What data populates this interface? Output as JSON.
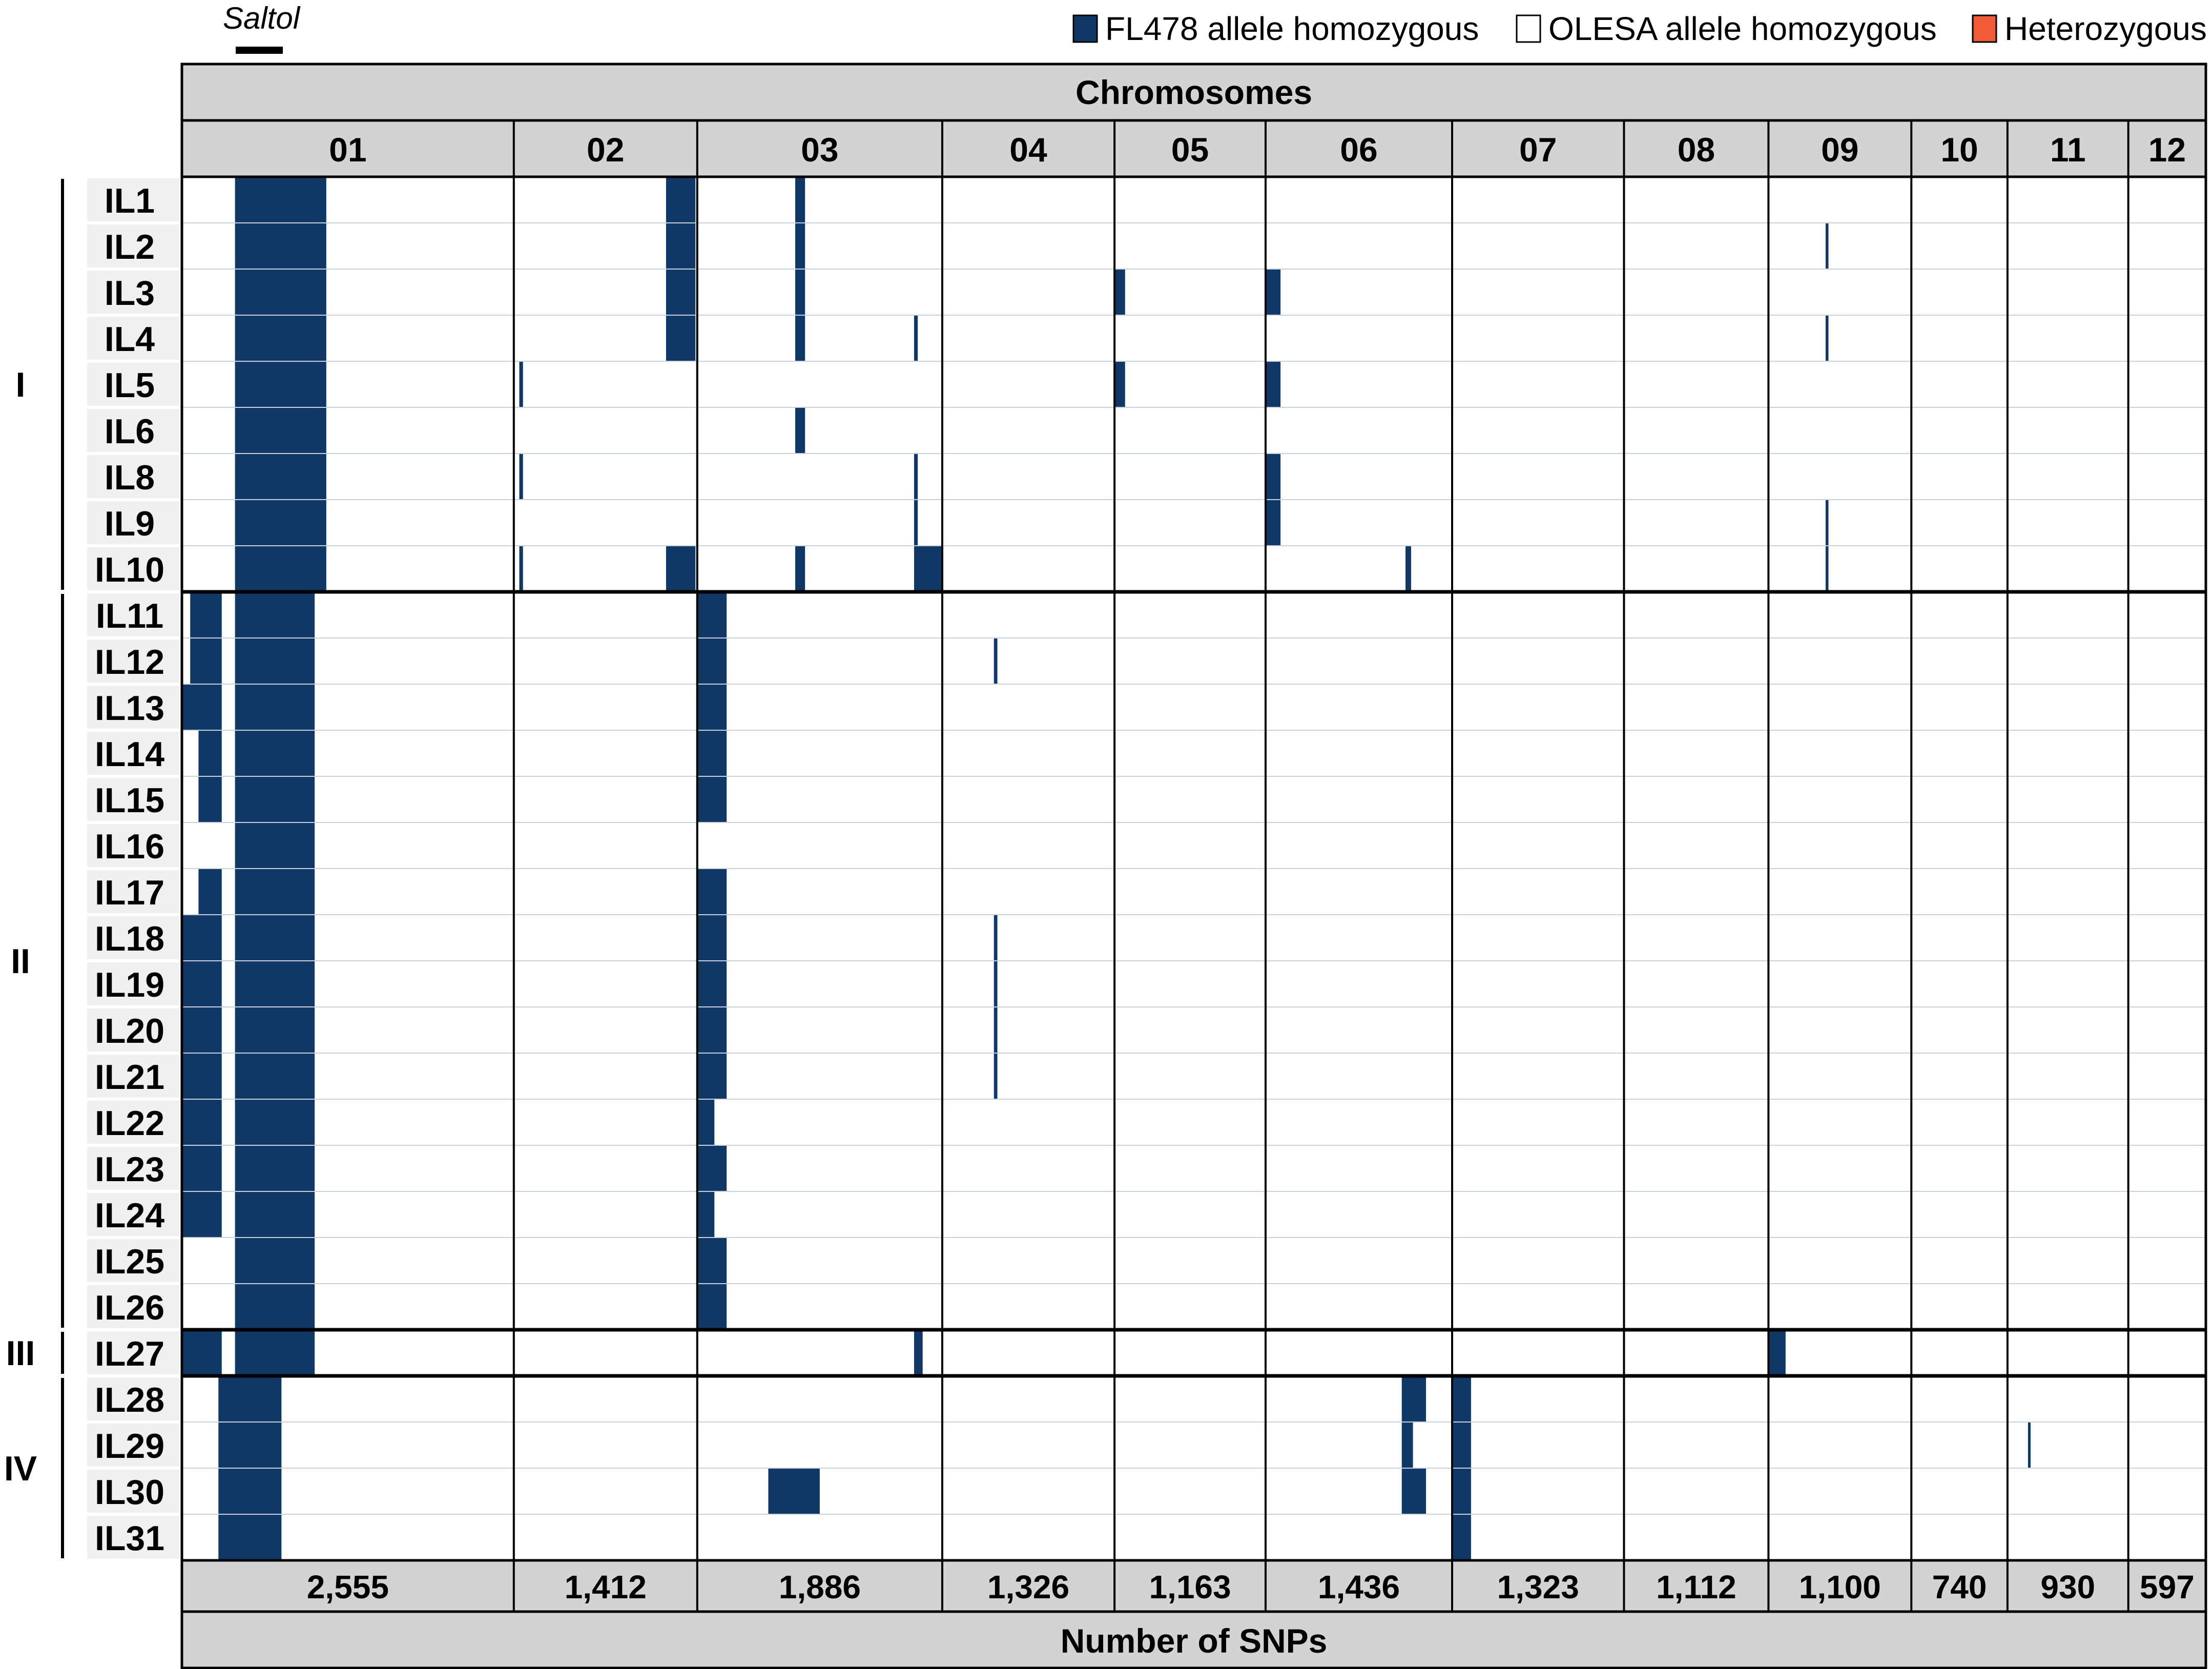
{
  "chart_data": {
    "type": "heatmap",
    "title": "Chromosomes",
    "xlabel": "Number of SNPs",
    "region_marker": "Saltol",
    "legend": [
      {
        "label": "FL478 allele homozygous",
        "color": "#0f3866"
      },
      {
        "label": "OLESA allele homozygous",
        "color": "#ffffff"
      },
      {
        "label": "Heterozygous",
        "color": "#f05a35"
      }
    ],
    "chromosomes": [
      {
        "label": "01",
        "snps": "2,555",
        "weight": 2555
      },
      {
        "label": "02",
        "snps": "1,412",
        "weight": 1412
      },
      {
        "label": "03",
        "snps": "1,886",
        "weight": 1886
      },
      {
        "label": "04",
        "snps": "1,326",
        "weight": 1326
      },
      {
        "label": "05",
        "snps": "1,163",
        "weight": 1163
      },
      {
        "label": "06",
        "snps": "1,436",
        "weight": 1436
      },
      {
        "label": "07",
        "snps": "1,323",
        "weight": 1323
      },
      {
        "label": "08",
        "snps": "1,112",
        "weight": 1112
      },
      {
        "label": "09",
        "snps": "1,100",
        "weight": 1100
      },
      {
        "label": "10",
        "snps": "740",
        "weight": 740
      },
      {
        "label": "11",
        "snps": "930",
        "weight": 930
      },
      {
        "label": "12",
        "snps": "597",
        "weight": 597
      }
    ],
    "groups": [
      {
        "label": "I",
        "lines": [
          "IL1",
          "IL2",
          "IL3",
          "IL4",
          "IL5",
          "IL6",
          "IL8",
          "IL9",
          "IL10"
        ]
      },
      {
        "label": "II",
        "lines": [
          "IL11",
          "IL12",
          "IL13",
          "IL14",
          "IL15",
          "IL16",
          "IL17",
          "IL18",
          "IL19",
          "IL20",
          "IL21",
          "IL22",
          "IL23",
          "IL24",
          "IL25",
          "IL26"
        ]
      },
      {
        "label": "III",
        "lines": [
          "IL27"
        ]
      },
      {
        "label": "IV",
        "lines": [
          "IL28",
          "IL29",
          "IL30",
          "IL31"
        ]
      }
    ],
    "introgressions": {
      "IL1": [
        [
          "01",
          0.16,
          0.435
        ],
        [
          "02",
          0.83,
          0.99
        ],
        [
          "03",
          0.4,
          0.44
        ]
      ],
      "IL2": [
        [
          "01",
          0.16,
          0.435
        ],
        [
          "02",
          0.83,
          0.99
        ],
        [
          "03",
          0.4,
          0.44
        ],
        [
          "09",
          0.4,
          0.42
        ]
      ],
      "IL3": [
        [
          "01",
          0.16,
          0.435
        ],
        [
          "02",
          0.83,
          0.99
        ],
        [
          "03",
          0.4,
          0.44
        ],
        [
          "05",
          0.0,
          0.07
        ],
        [
          "06",
          0.0,
          0.08
        ]
      ],
      "IL4": [
        [
          "01",
          0.16,
          0.435
        ],
        [
          "02",
          0.83,
          0.99
        ],
        [
          "03",
          0.4,
          0.44
        ],
        [
          "03",
          0.885,
          0.9
        ],
        [
          "09",
          0.4,
          0.42
        ]
      ],
      "IL5": [
        [
          "01",
          0.16,
          0.435
        ],
        [
          "02",
          0.03,
          0.05
        ],
        [
          "05",
          0.0,
          0.07
        ],
        [
          "06",
          0.0,
          0.08
        ]
      ],
      "IL6": [
        [
          "01",
          0.16,
          0.435
        ],
        [
          "03",
          0.4,
          0.44
        ]
      ],
      "IL8": [
        [
          "01",
          0.16,
          0.435
        ],
        [
          "02",
          0.03,
          0.05
        ],
        [
          "03",
          0.885,
          0.9
        ],
        [
          "06",
          0.0,
          0.08
        ]
      ],
      "IL9": [
        [
          "01",
          0.16,
          0.435
        ],
        [
          "03",
          0.885,
          0.9
        ],
        [
          "06",
          0.0,
          0.08
        ],
        [
          "09",
          0.4,
          0.42
        ]
      ],
      "IL10": [
        [
          "01",
          0.16,
          0.435
        ],
        [
          "02",
          0.03,
          0.05
        ],
        [
          "02",
          0.83,
          0.99
        ],
        [
          "03",
          0.4,
          0.44
        ],
        [
          "03",
          0.885,
          1.0
        ],
        [
          "06",
          0.75,
          0.78
        ],
        [
          "09",
          0.4,
          0.42
        ]
      ],
      "IL11": [
        [
          "01",
          0.025,
          0.12
        ],
        [
          "01",
          0.16,
          0.4
        ],
        [
          "03",
          0.0,
          0.12
        ]
      ],
      "IL12": [
        [
          "01",
          0.025,
          0.12
        ],
        [
          "01",
          0.16,
          0.4
        ],
        [
          "03",
          0.0,
          0.12
        ],
        [
          "04",
          0.3,
          0.32
        ]
      ],
      "IL13": [
        [
          "01",
          0.0,
          0.12
        ],
        [
          "01",
          0.16,
          0.4
        ],
        [
          "03",
          0.0,
          0.12
        ]
      ],
      "IL14": [
        [
          "01",
          0.05,
          0.12
        ],
        [
          "01",
          0.16,
          0.4
        ],
        [
          "03",
          0.0,
          0.12
        ]
      ],
      "IL15": [
        [
          "01",
          0.05,
          0.12
        ],
        [
          "01",
          0.16,
          0.4
        ],
        [
          "03",
          0.0,
          0.12
        ]
      ],
      "IL16": [
        [
          "01",
          0.16,
          0.4
        ]
      ],
      "IL17": [
        [
          "01",
          0.05,
          0.12
        ],
        [
          "01",
          0.16,
          0.4
        ],
        [
          "03",
          0.0,
          0.12
        ]
      ],
      "IL18": [
        [
          "01",
          0.0,
          0.12
        ],
        [
          "01",
          0.16,
          0.4
        ],
        [
          "03",
          0.0,
          0.12
        ],
        [
          "04",
          0.3,
          0.32
        ]
      ],
      "IL19": [
        [
          "01",
          0.0,
          0.12
        ],
        [
          "01",
          0.16,
          0.4
        ],
        [
          "03",
          0.0,
          0.12
        ],
        [
          "04",
          0.3,
          0.32
        ]
      ],
      "IL20": [
        [
          "01",
          0.0,
          0.12
        ],
        [
          "01",
          0.16,
          0.4
        ],
        [
          "03",
          0.0,
          0.12
        ],
        [
          "04",
          0.3,
          0.32
        ]
      ],
      "IL21": [
        [
          "01",
          0.0,
          0.12
        ],
        [
          "01",
          0.16,
          0.4
        ],
        [
          "03",
          0.0,
          0.12
        ],
        [
          "04",
          0.3,
          0.32
        ]
      ],
      "IL22": [
        [
          "01",
          0.0,
          0.12
        ],
        [
          "01",
          0.16,
          0.4
        ],
        [
          "03",
          0.0,
          0.07
        ]
      ],
      "IL23": [
        [
          "01",
          0.0,
          0.12
        ],
        [
          "01",
          0.16,
          0.4
        ],
        [
          "03",
          0.0,
          0.12
        ]
      ],
      "IL24": [
        [
          "01",
          0.0,
          0.12
        ],
        [
          "01",
          0.16,
          0.4
        ],
        [
          "03",
          0.0,
          0.07
        ]
      ],
      "IL25": [
        [
          "01",
          0.16,
          0.4
        ],
        [
          "03",
          0.0,
          0.12
        ]
      ],
      "IL26": [
        [
          "01",
          0.16,
          0.4
        ],
        [
          "03",
          0.0,
          0.12
        ]
      ],
      "IL27": [
        [
          "01",
          0.0,
          0.12
        ],
        [
          "01",
          0.16,
          0.4
        ],
        [
          "03",
          0.885,
          0.92
        ],
        [
          "09",
          0.0,
          0.12
        ]
      ],
      "IL28": [
        [
          "01",
          0.11,
          0.3
        ],
        [
          "06",
          0.73,
          0.86
        ],
        [
          "07",
          0.0,
          0.11
        ]
      ],
      "IL29": [
        [
          "01",
          0.11,
          0.3
        ],
        [
          "06",
          0.73,
          0.79
        ],
        [
          "07",
          0.0,
          0.11
        ],
        [
          "11",
          0.17,
          0.19
        ]
      ],
      "IL30": [
        [
          "01",
          0.11,
          0.3
        ],
        [
          "03",
          0.29,
          0.5
        ],
        [
          "06",
          0.73,
          0.86
        ],
        [
          "07",
          0.0,
          0.11
        ]
      ],
      "IL31": [
        [
          "01",
          0.11,
          0.3
        ],
        [
          "07",
          0.0,
          0.11
        ]
      ]
    }
  }
}
